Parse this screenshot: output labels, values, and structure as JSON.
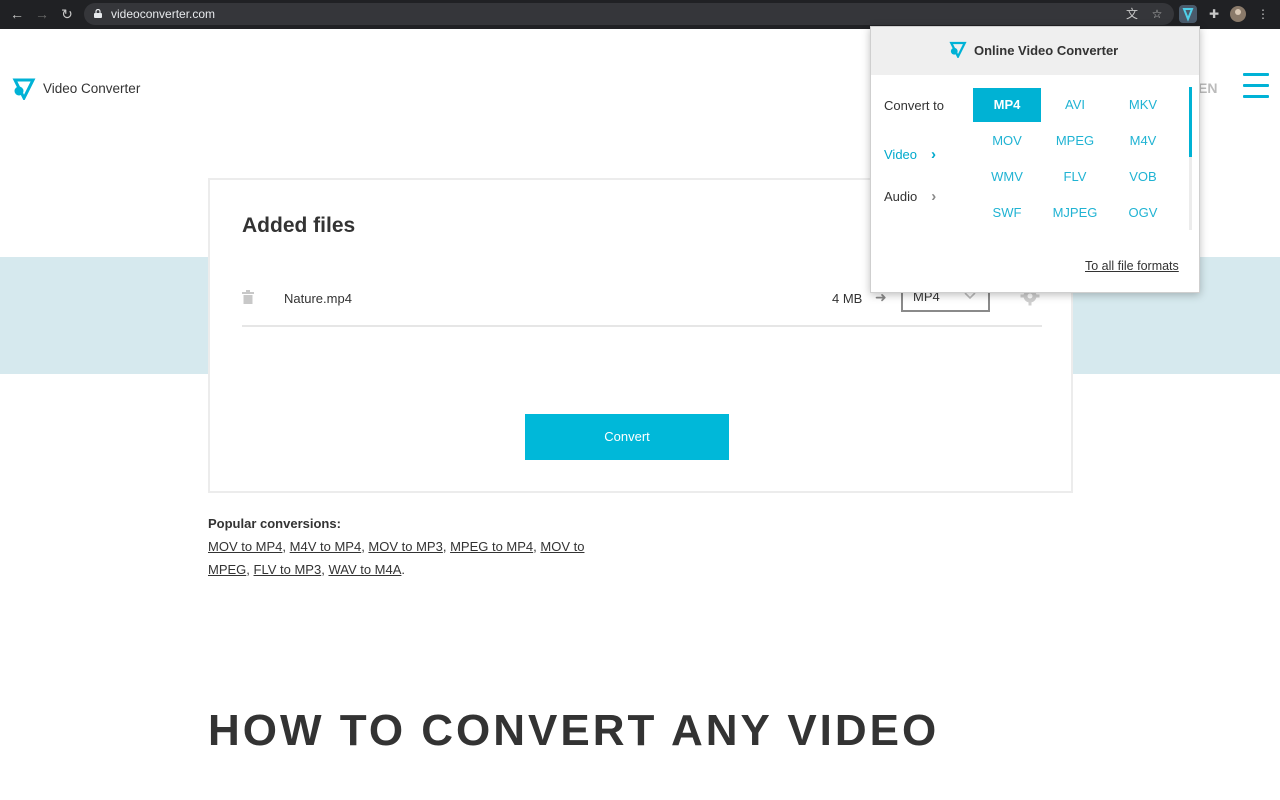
{
  "browser": {
    "url": "videoconverter.com"
  },
  "site": {
    "brand_name": "Video Converter",
    "language": "EN"
  },
  "card": {
    "title": "Added files",
    "file": {
      "name": "Nature.mp4",
      "size": "4 MB",
      "format": "MP4"
    },
    "convert_label": "Convert"
  },
  "popular": {
    "title": "Popular conversions:",
    "links": [
      "MOV to MP4",
      "M4V to MP4",
      "MOV to MP3",
      "MPEG to MP4",
      "MOV to MPEG",
      "FLV to MP3",
      "WAV to M4A"
    ]
  },
  "heading": "HOW TO CONVERT ANY VIDEO",
  "popup": {
    "title": "Online Video Converter",
    "convert_to_label": "Convert to",
    "categories": [
      {
        "label": "Video",
        "active": true
      },
      {
        "label": "Audio",
        "active": false
      }
    ],
    "formats": [
      "MP4",
      "AVI",
      "MKV",
      "MOV",
      "MPEG",
      "M4V",
      "WMV",
      "FLV",
      "VOB",
      "SWF",
      "MJPEG",
      "OGV"
    ],
    "selected_format": "MP4",
    "all_formats_label": "To all file formats"
  },
  "colors": {
    "accent": "#00b8d9",
    "band": "#d6e9ee",
    "chrome": "#202124"
  },
  "icons": [
    "back-arrow-icon",
    "forward-arrow-icon",
    "reload-icon",
    "lock-icon",
    "translate-icon",
    "star-icon",
    "extension-icon",
    "puzzle-icon",
    "profile-avatar",
    "menu-dots-icon",
    "logo-icon",
    "hamburger-icon",
    "trash-icon",
    "arrow-right-icon",
    "chevron-down-icon",
    "gear-icon"
  ]
}
